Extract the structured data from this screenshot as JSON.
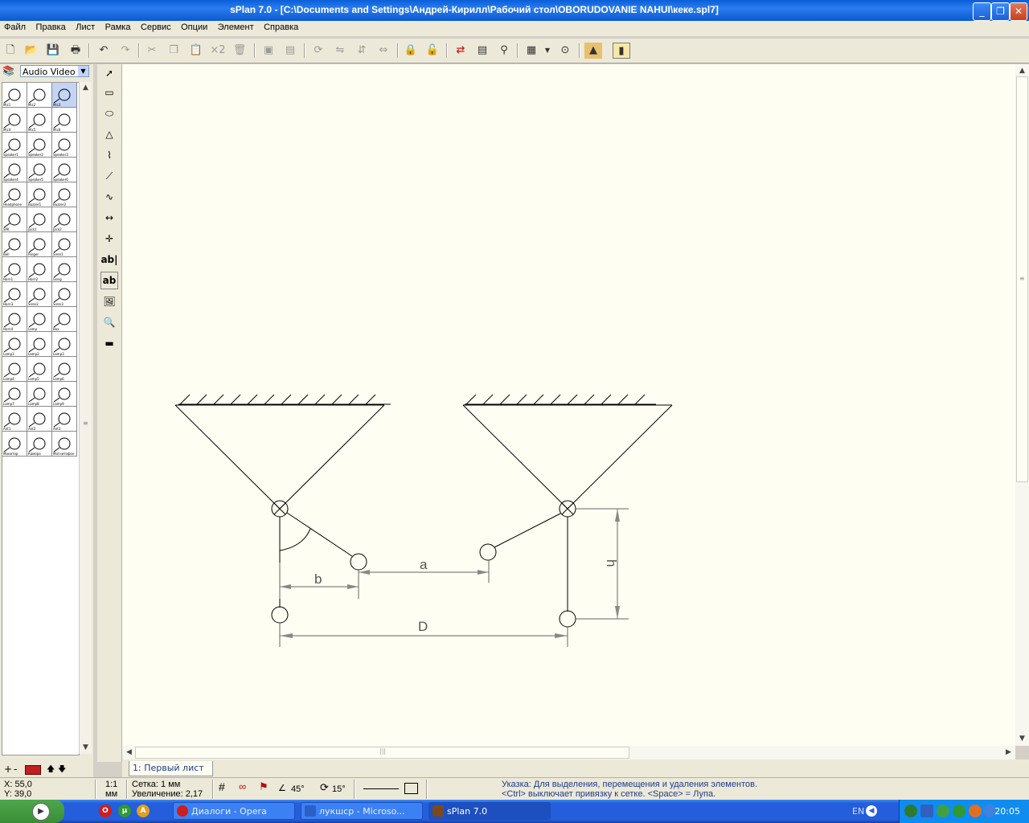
{
  "window": {
    "title": "sPlan 7.0 - [C:\\Documents and Settings\\Андрей-Кирилл\\Рабочий стол\\OBORUDOVANIE NAHUI\\кеке.spl7]",
    "minimize_glyph": "_",
    "restore_glyph": "❐",
    "close_glyph": "✕"
  },
  "menu": [
    "Файл",
    "Правка",
    "Лист",
    "Рамка",
    "Сервис",
    "Опции",
    "Элемент",
    "Справка"
  ],
  "toolbar": {
    "multiply_label": "×2",
    "icons": [
      "new-icon",
      "open-icon",
      "save-icon",
      "print-icon",
      "undo-icon",
      "redo-icon",
      "cut-icon",
      "copy-icon",
      "paste-icon",
      "duplicate-icon",
      "delete-icon",
      "group-icon",
      "ungroup-icon",
      "rotate-icon",
      "mirror-h-icon",
      "mirror-v-icon",
      "align-icon",
      "lock-icon",
      "unlock-icon",
      "netlist-icon",
      "list-icon",
      "find-icon",
      "grid-icon",
      "zoom-fit-icon",
      "frame-icon",
      "sheet-icon"
    ]
  },
  "library": {
    "selected": "Audio Video",
    "symbols": [
      "Mic1",
      "Mic2",
      "Mic3",
      "Mic4",
      "Mic5",
      "Mic6",
      "Speaker1",
      "Speaker2",
      "Speaker3",
      "Speaker4",
      "Speaker5",
      "Speaker6",
      "Headphone",
      "Buzzer1",
      "Buzzer2",
      "SPK",
      "Jack1",
      "Jack2",
      "Bell",
      "Ringer",
      "Siren1",
      "Horn1",
      "Horn2",
      "Gong",
      "Horn3",
      "Siren2",
      "Siren3",
      "Horn4",
      "Lamp",
      "Box",
      "Lamp1",
      "Lamp2",
      "Lamp3",
      "Lamp4",
      "Lamp5",
      "Lamp6",
      "Lamp7",
      "Lamp8",
      "Lamp9",
      "Ant1",
      "Ant2",
      "Ant3",
      "Монитор",
      "Камера",
      "Магнитофон"
    ]
  },
  "tools": [
    "pointer-icon",
    "rectangle-icon",
    "ellipse-icon",
    "polygon-icon",
    "bezier-icon",
    "polyline-icon",
    "curve-icon",
    "dimension-icon",
    "junction-icon",
    "text-icon",
    "textbox-icon",
    "image-icon",
    "zoom-icon",
    "ruler-icon"
  ],
  "tools_text": {
    "text": "ab|",
    "textbox": "ab"
  },
  "drawing": {
    "labels": {
      "a": "a",
      "b": "b",
      "D": "D",
      "h": "h"
    }
  },
  "sheet_tab": "1: Первый лист",
  "status": {
    "x": "X: 55,0",
    "y": "Y: 39,0",
    "scale": "1:1",
    "unit": "мм",
    "grid": "Сетка: 1 мм",
    "zoom": "Увеличение:  2,17",
    "angle1": "45°",
    "angle2": "15°",
    "hint1": "Указка: Для выделения, перемещения и удаления элементов.",
    "hint2": "<Ctrl> выключает привязку к сетке. <Space> = Лупа."
  },
  "taskbar": {
    "tasks": [
      {
        "label": "Диалоги - Opera",
        "active": false,
        "color": "#d01c1c"
      },
      {
        "label": "лукшср - Microso...",
        "active": false,
        "color": "#2b5fc8"
      },
      {
        "label": "sPlan 7.0",
        "active": true,
        "color": "#7a4a1c"
      }
    ],
    "lang": "EN",
    "clock": "20:05"
  }
}
